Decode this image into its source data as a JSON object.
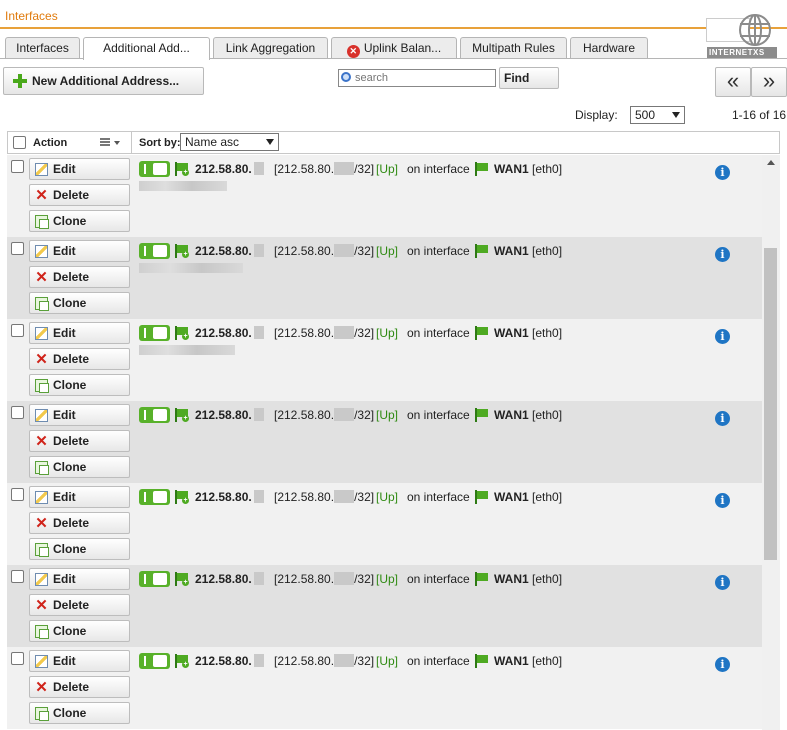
{
  "title": "Interfaces",
  "logo": {
    "text": "INTERNET",
    "suffix": "XS",
    "icon": "globe-icon"
  },
  "tabs": [
    {
      "label": "Interfaces",
      "active": false
    },
    {
      "label": "Additional Add...",
      "active": true
    },
    {
      "label": "Link Aggregation",
      "active": false
    },
    {
      "label": "Uplink Balan...",
      "active": false,
      "icon": "error-icon"
    },
    {
      "label": "Multipath Rules",
      "active": false
    },
    {
      "label": "Hardware",
      "active": false
    }
  ],
  "toolbar": {
    "new_label": "New Additional Address...",
    "search_placeholder": "search",
    "find_label": "Find",
    "prev_label": "«",
    "next_label": "»"
  },
  "display": {
    "label": "Display:",
    "value": "500",
    "count": "1-16 of 16"
  },
  "table": {
    "action_label": "Action",
    "sort_label": "Sort by:",
    "sort_value": "Name asc",
    "edit_label": "Edit",
    "delete_label": "Delete",
    "clone_label": "Clone"
  },
  "rows": [
    {
      "address": "212.58.80.",
      "cidr_prefix": "[212.58.80.",
      "cidr_suffix": "/32]",
      "status": "[Up]",
      "on_interface": "on interface",
      "iface": "WAN1",
      "hw": "[eth0]"
    },
    {
      "address": "212.58.80.",
      "cidr_prefix": "[212.58.80.",
      "cidr_suffix": "/32]",
      "status": "[Up]",
      "on_interface": "on interface",
      "iface": "WAN1",
      "hw": "[eth0]"
    },
    {
      "address": "212.58.80.",
      "cidr_prefix": "[212.58.80.",
      "cidr_suffix": "/32]",
      "status": "[Up]",
      "on_interface": "on interface",
      "iface": "WAN1",
      "hw": "[eth0]"
    },
    {
      "address": "212.58.80.",
      "cidr_prefix": "[212.58.80.",
      "cidr_suffix": "/32]",
      "status": "[Up]",
      "on_interface": "on interface",
      "iface": "WAN1",
      "hw": "[eth0]"
    },
    {
      "address": "212.58.80.",
      "cidr_prefix": "[212.58.80.",
      "cidr_suffix": "/32]",
      "status": "[Up]",
      "on_interface": "on interface",
      "iface": "WAN1",
      "hw": "[eth0]"
    },
    {
      "address": "212.58.80.",
      "cidr_prefix": "[212.58.80.",
      "cidr_suffix": "/32]",
      "status": "[Up]",
      "on_interface": "on interface",
      "iface": "WAN1",
      "hw": "[eth0]"
    },
    {
      "address": "212.58.80.",
      "cidr_prefix": "[212.58.80.",
      "cidr_suffix": "/32]",
      "status": "[Up]",
      "on_interface": "on interface",
      "iface": "WAN1",
      "hw": "[eth0]"
    }
  ],
  "colors": {
    "accent": "#e07b0d",
    "status_up": "#2f8a12",
    "toggle_on": "#58b12a",
    "info": "#1f75c4"
  }
}
